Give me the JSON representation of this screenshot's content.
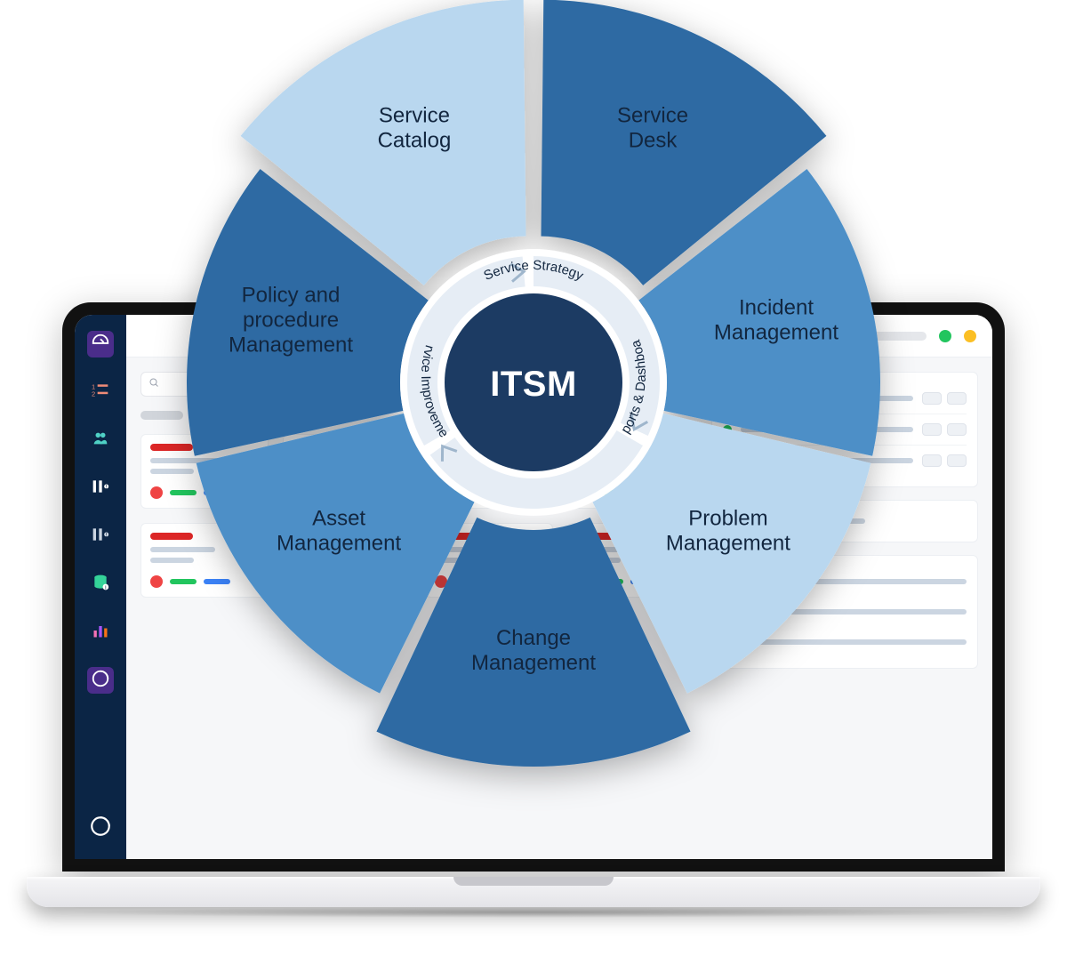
{
  "center": {
    "title": "ITSM",
    "ring_labels": {
      "top": "Service Strategy",
      "right": "Reports & Dashboard",
      "left": "Service Improvement"
    }
  },
  "segments": [
    {
      "id": "service-desk",
      "label_line1": "Service",
      "label_line2": "Desk",
      "color": "#2d6aa3"
    },
    {
      "id": "incident-management",
      "label_line1": "Incident",
      "label_line2": "Management",
      "color": "#4e8fc7"
    },
    {
      "id": "problem-management",
      "label_line1": "Problem",
      "label_line2": "Management",
      "color": "#b9d7ef"
    },
    {
      "id": "change-management",
      "label_line1": "Change",
      "label_line2": "Management",
      "color": "#2d6aa3"
    },
    {
      "id": "asset-management",
      "label_line1": "Asset",
      "label_line2": "Management",
      "color": "#4e8fc7"
    },
    {
      "id": "policy-procedure-management",
      "label_line1": "Policy and",
      "label_line2": "procedure",
      "label_line3": "Management",
      "color": "#2d6aa3"
    },
    {
      "id": "service-catalog",
      "label_line1": "Service",
      "label_line2": "Catalog",
      "color": "#b9d7ef"
    }
  ],
  "colors": {
    "dark_navy": "#1c3b63",
    "white": "#ffffff"
  },
  "laptop_ui": {
    "rp_badge": "0"
  }
}
